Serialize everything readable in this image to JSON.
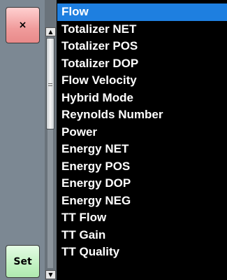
{
  "sidebar": {
    "close_button": {
      "label": "×",
      "icon": "close-icon",
      "color": "#f09b9b"
    },
    "set_button": {
      "label": "Set",
      "color": "#c2f2c2"
    }
  },
  "scrollbar": {
    "up_arrow": "▲",
    "down_arrow": "▼",
    "position": 0.0
  },
  "list": {
    "selected_color": "#1e7fe0",
    "selected_index": 0,
    "items": [
      {
        "label": "Flow"
      },
      {
        "label": "Totalizer NET"
      },
      {
        "label": "Totalizer POS"
      },
      {
        "label": "Totalizer DOP"
      },
      {
        "label": "Flow Velocity"
      },
      {
        "label": "Hybrid Mode"
      },
      {
        "label": "Reynolds Number"
      },
      {
        "label": "Power"
      },
      {
        "label": "Energy NET"
      },
      {
        "label": "Energy POS"
      },
      {
        "label": "Energy DOP"
      },
      {
        "label": "Energy NEG"
      },
      {
        "label": "TT Flow"
      },
      {
        "label": "TT Gain"
      },
      {
        "label": "TT Quality"
      }
    ]
  }
}
